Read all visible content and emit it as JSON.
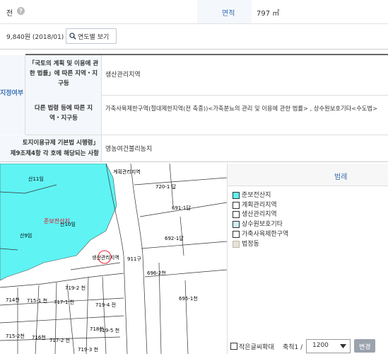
{
  "top_row": {
    "value_left": "전",
    "area_label": "면적",
    "area_value": "797 ㎡"
  },
  "price_row": {
    "price": "9,840원 (2018/01)",
    "year_button": "연도별 보기"
  },
  "zone_section": {
    "side_label": "지정여부",
    "rows": [
      {
        "label": "「국토의 계획 및 이용에 관한 법률」에 따른 지역・지구등",
        "value": "생산관리지역"
      },
      {
        "label": "다른 법령 등에 따른 지역・지구등",
        "value": "가축사육제한구역(절대제한지역(전 축종))<가축분뇨의 관리 및 이용에 관한 법률> , 상수원보호기타<수도법>"
      }
    ]
  },
  "regulation_row": {
    "label_line1": "토지이용규제 기본법 시행령」",
    "label_line2": "제9조제4항 각 호에 해당되는 사항",
    "value": "영농여건불리농지"
  },
  "map": {
    "labels": {
      "l1": "산11임",
      "l2": "준보전산지",
      "l3": "산10임",
      "l4": "산9임",
      "l5": "계획관리지역",
      "l6": "720-1 답",
      "l7": "691-1답",
      "l8": "692-1답",
      "l9": "생산관리지역",
      "l10": "911구",
      "l11": "696-2천",
      "l12": "719-2 천",
      "l13": "719-4 전",
      "l14": "714천",
      "l15": "715-1 천",
      "l16": "717-1 천",
      "l17": "718천",
      "l18": "719-5 천",
      "l19": "695-1천",
      "l20": "715-2천",
      "l21": "716천",
      "l22": "717-2 천",
      "l23": "719-3 천"
    }
  },
  "legend": {
    "title": "범례",
    "items": [
      {
        "label": "준보전산지",
        "color": "#5ff3f3"
      },
      {
        "label": "계획관리지역",
        "color": "#ffffff"
      },
      {
        "label": "생산관리지역",
        "color": "#ffffff"
      },
      {
        "label": "상수원보호기타",
        "color": "#cfeff7"
      },
      {
        "label": "가축사육제한구역",
        "color": "#ffffff"
      },
      {
        "label": "법정동",
        "color": "#e8e0d6"
      }
    ]
  },
  "map_footer": {
    "large_text_label": "작은글씨확대",
    "scale_label": "축척1 /",
    "scale_value": "1200",
    "change_button": "변경"
  }
}
